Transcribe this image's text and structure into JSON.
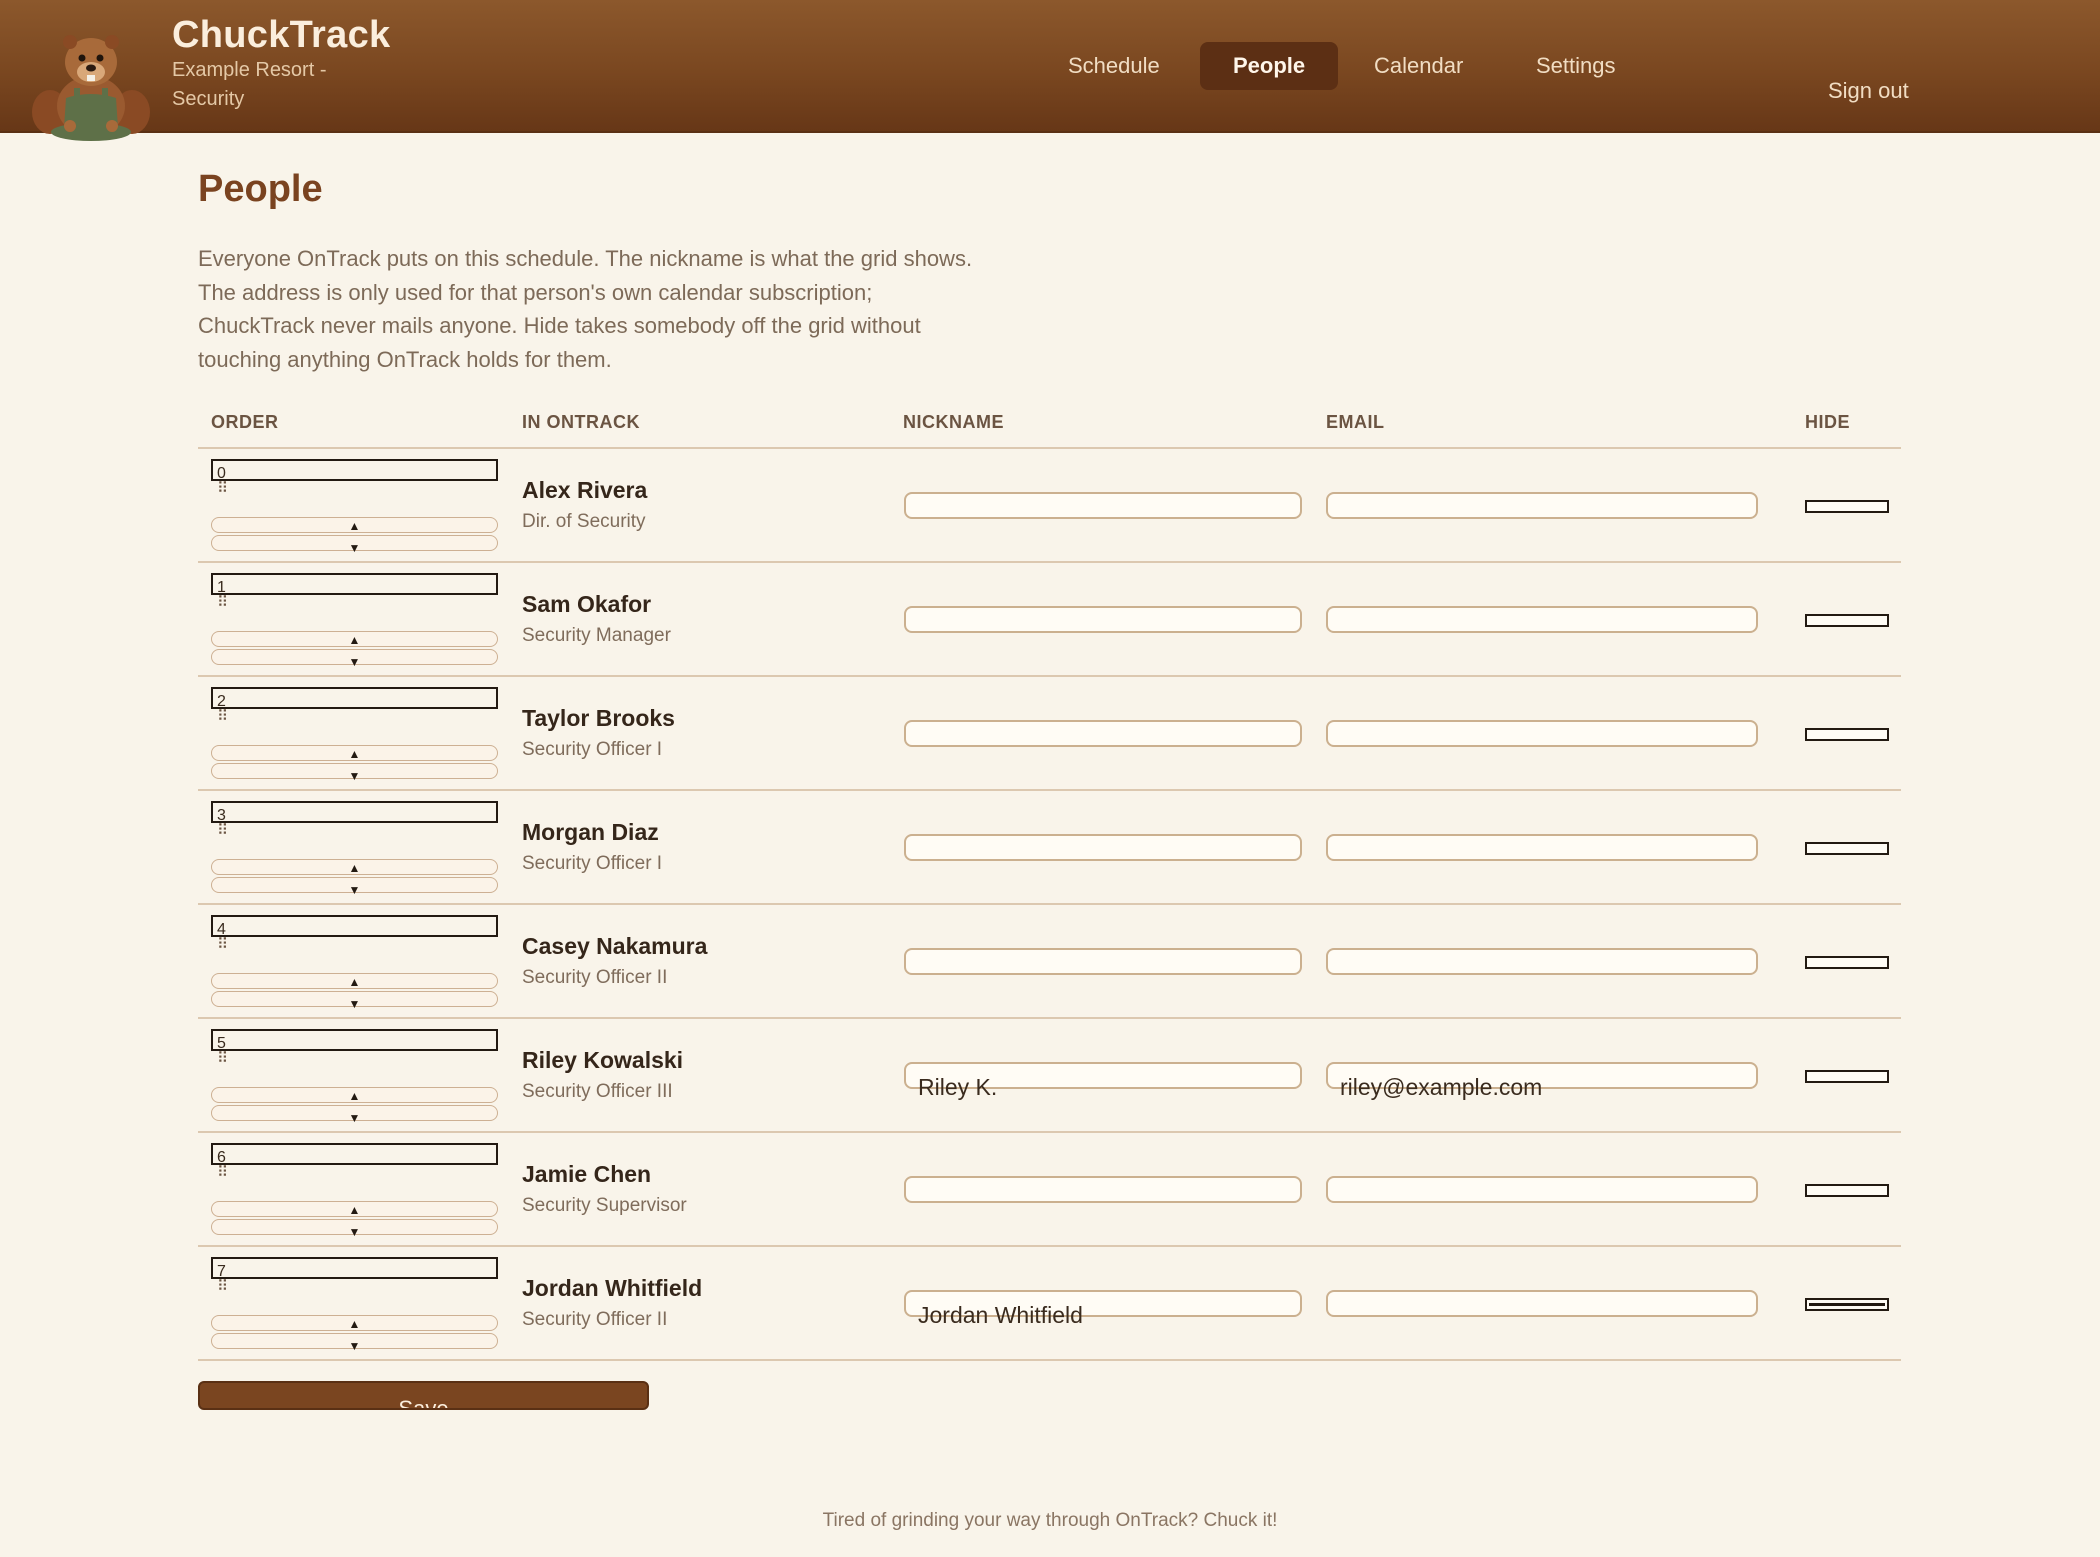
{
  "app": {
    "name": "ChuckTrack",
    "subtitle": "Example Resort - Security"
  },
  "nav": {
    "items": [
      "Schedule",
      "People",
      "Calendar",
      "Settings"
    ],
    "active": "People",
    "signout": "Sign out"
  },
  "page": {
    "title": "People",
    "intro": [
      "Everyone OnTrack puts on this schedule. The nickname is what the grid shows.",
      "The address is only used for that person's own calendar subscription;",
      "ChuckTrack never mails anyone. Hide takes somebody off the grid without",
      "touching anything OnTrack holds for them."
    ]
  },
  "table": {
    "headers": {
      "order": "ORDER",
      "in_ontrack": "IN ONTRACK",
      "nickname": "NICKNAME",
      "email": "EMAIL",
      "hide": "HIDE"
    },
    "rows": [
      {
        "order": "0",
        "name": "Alex Rivera",
        "title": "Dir. of Security",
        "nickname": "",
        "email": "",
        "hidden": false
      },
      {
        "order": "1",
        "name": "Sam Okafor",
        "title": "Security Manager",
        "nickname": "",
        "email": "",
        "hidden": false
      },
      {
        "order": "2",
        "name": "Taylor Brooks",
        "title": "Security Officer I",
        "nickname": "",
        "email": "",
        "hidden": false
      },
      {
        "order": "3",
        "name": "Morgan Diaz",
        "title": "Security Officer I",
        "nickname": "",
        "email": "",
        "hidden": false
      },
      {
        "order": "4",
        "name": "Casey Nakamura",
        "title": "Security Officer II",
        "nickname": "",
        "email": "",
        "hidden": false
      },
      {
        "order": "5",
        "name": "Riley Kowalski",
        "title": "Security Officer III",
        "nickname": "Riley K.",
        "email": "riley@example.com",
        "hidden": false
      },
      {
        "order": "6",
        "name": "Jamie Chen",
        "title": "Security Supervisor",
        "nickname": "",
        "email": "",
        "hidden": false
      },
      {
        "order": "7",
        "name": "Jordan Whitfield",
        "title": "Security Officer II",
        "nickname": "Jordan Whitfield",
        "email": "",
        "hidden": true
      }
    ],
    "step_up_icon": "▲",
    "step_down_icon": "▼",
    "drag_icon": "drag-handle-icon"
  },
  "actions": {
    "save_label": "Save"
  },
  "footer": {
    "text": "Tired of grinding your way through OnTrack? Chuck it!"
  },
  "colors": {
    "header": "#7a4720",
    "accent": "#7a4320",
    "background": "#f9f4ea"
  }
}
